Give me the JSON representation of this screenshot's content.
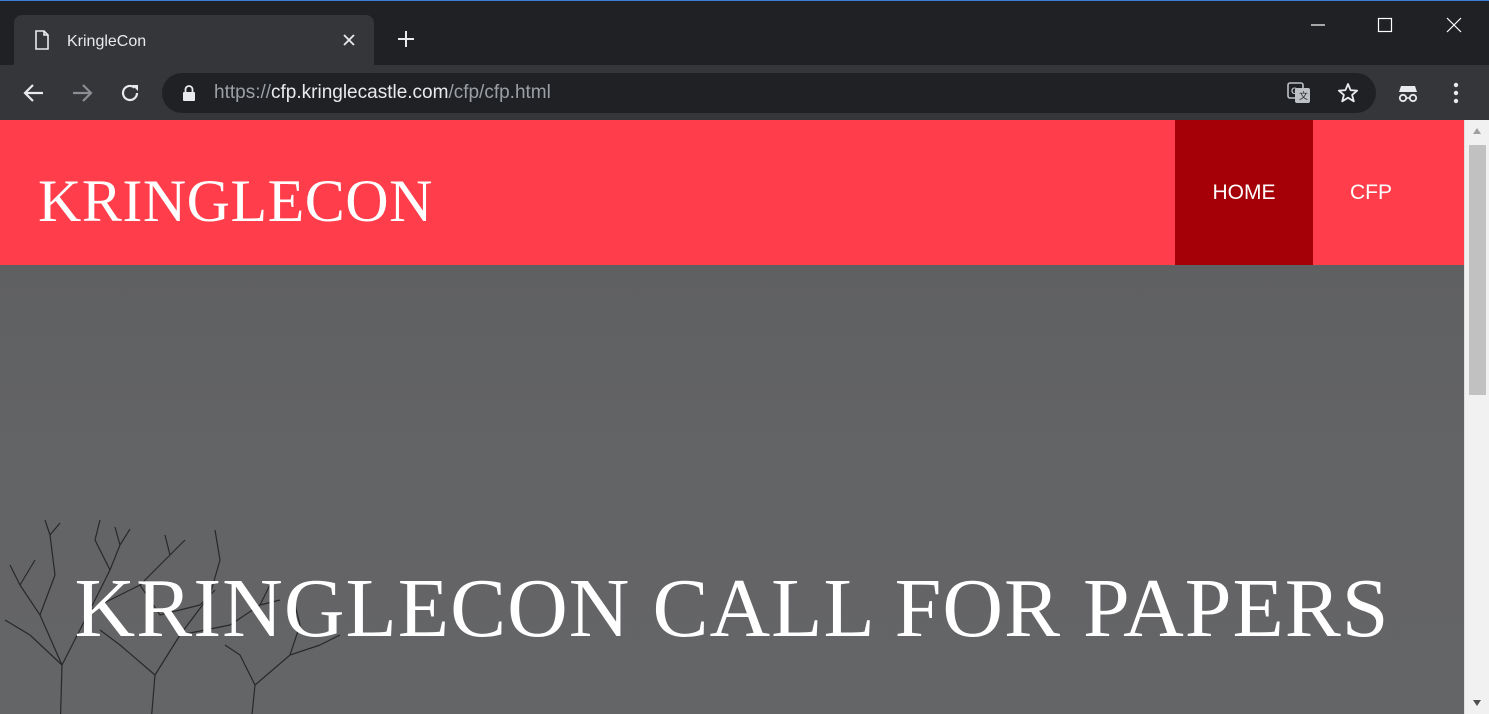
{
  "browser": {
    "tab_title": "KringleCon",
    "url_scheme": "https://",
    "url_host": "cfp.kringlecastle.com",
    "url_path": "/cfp/cfp.html",
    "icons": [
      "page-icon",
      "close-icon",
      "plus-icon",
      "minimize-icon",
      "maximize-icon",
      "close-window-icon",
      "back-icon",
      "forward-icon",
      "reload-icon",
      "lock-icon",
      "translate-icon",
      "star-icon",
      "incognito-icon",
      "kebab-menu-icon"
    ]
  },
  "site": {
    "brand": "KRINGLECON",
    "nav": [
      {
        "label": "HOME",
        "active": true
      },
      {
        "label": "CFP",
        "active": false
      }
    ],
    "hero_title": "KRINGLECON CALL FOR PAPERS"
  },
  "colors": {
    "header_bg": "#ff3d4b",
    "nav_active_bg": "#a50007",
    "hero_bg": "#626365"
  }
}
